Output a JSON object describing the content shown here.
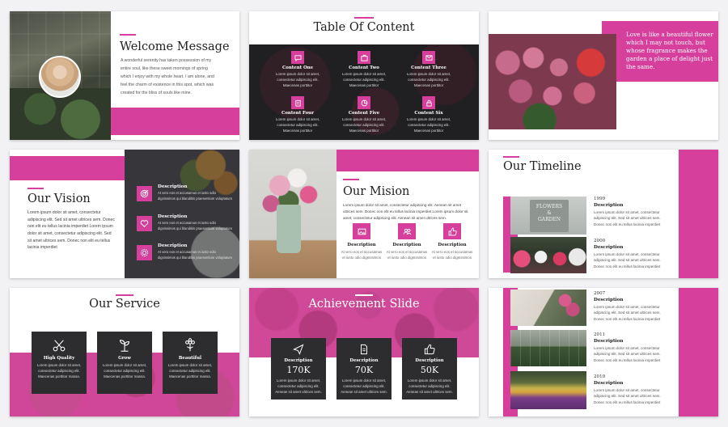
{
  "colors": {
    "accent": "#d63f9b",
    "dark": "#2d2d2f"
  },
  "s1": {
    "title": "Welcome Message",
    "body": "A wonderful serenity has taken possession of my entire soul, like these sweet mornings of spring which I enjoy with my whole heart. I am alone, and feel the charm of existence in this spot, which was created for the bliss of souls like mine."
  },
  "s2": {
    "title": "Table Of Content",
    "items": [
      {
        "title": "Content One",
        "desc": "Lorem ipsum dolor sit amet, consectetur adipiscing elit. Maecenas porttitor",
        "icon": "chat-icon"
      },
      {
        "title": "Content Two",
        "desc": "Lorem ipsum dolor sit amet, consectetur adipiscing elit. Maecenas porttitor",
        "icon": "briefcase-icon"
      },
      {
        "title": "Content Three",
        "desc": "Lorem ipsum dolor sit amet, consectetur adipiscing elit. Maecenas porttitor",
        "icon": "email-icon"
      },
      {
        "title": "Content Four",
        "desc": "Lorem ipsum dolor sit amet, consectetur adipiscing elit. Maecenas porttitor",
        "icon": "clipboard-icon"
      },
      {
        "title": "Content Five",
        "desc": "Lorem ipsum dolor sit amet, consectetur adipiscing elit. Maecenas porttitor",
        "icon": "pie-icon"
      },
      {
        "title": "Content Six",
        "desc": "Lorem ipsum dolor sit amet, consectetur adipiscing elit. Maecenas porttitor",
        "icon": "lock-icon"
      }
    ]
  },
  "s3": {
    "quote": "Love is like a beautiful flower which I may not touch, but whose fragrance makes the garden a place of delight just the same."
  },
  "s4": {
    "title": "Our Vision",
    "body": "Lorem ipsum dolor sit amet, consectetur adipiscing elit. Sed sit amet ultrices sem. Donec non elit eu tellus lacinia imperdiet Lorem ipsum dolor sit amet, consectetur adipiscing elit. Sed sit amet ultrices sem. Donec non elit eu tellus lacinia imperdiet",
    "items": [
      {
        "title": "Description",
        "desc": "At vero eos et accusamus et iusto odio dignissimos qui blanditiis praesentium voluptatum"
      },
      {
        "title": "Description",
        "desc": "At vero eos et accusamus et iusto odio dignissimos qui blanditiis praesentium voluptatum"
      },
      {
        "title": "Description",
        "desc": "At vero eos et accusamus et iusto odio dignissimos qui blanditiis praesentium voluptatum"
      }
    ]
  },
  "s5": {
    "title": "Our Mision",
    "body": "Lorem ipsum dolor sit amet, consectetur adipiscing elit. Aenean sit amet ultrices sem. Donec non elit eu tellus lacinia imperdiet Lorem ipsum dolor sit amet, consectetur adipiscing elit. Aenean sit amet ultrices sem.",
    "items": [
      {
        "title": "Description",
        "desc": "At vero eos et accusamus et iusto odio dignissimos"
      },
      {
        "title": "Description",
        "desc": "At vero eos et accusamus et iusto odio dignissimos"
      },
      {
        "title": "Description",
        "desc": "At vero eos et accusamus et iusto odio dignissimos"
      }
    ]
  },
  "s6": {
    "title": "Our Timeline",
    "entries": [
      {
        "year": "1999",
        "title": "Description",
        "desc": "Lorem ipsum dolor sit amet, consectetur adipiscing elit. Sed sit amet ultrices sem. Donec non elit eu tellus lacinia imperdiet"
      },
      {
        "year": "2000",
        "title": "Description",
        "desc": "Lorem ipsum dolor sit amet, consectetur adipiscing elit. Sed sit amet ultrices sem. Donec non elit eu tellus lacinia imperdiet"
      }
    ],
    "sign_top": "FLOWERS",
    "sign_amp": "&",
    "sign_bottom": "GARDEN"
  },
  "s7": {
    "title": "Our Service",
    "items": [
      {
        "title": "High Quality",
        "desc": "Lorem ipsum dolor sit amet, consectetur adipiscing elit. Maecenas porttitor massa.",
        "icon": "scissors-icon"
      },
      {
        "title": "Grow",
        "desc": "Lorem ipsum dolor sit amet, consectetur adipiscing elit. Maecenas porttitor massa.",
        "icon": "sprout-icon"
      },
      {
        "title": "Beautiful",
        "desc": "Lorem ipsum dolor sit amet, consectetur adipiscing elit. Maecenas porttitor massa.",
        "icon": "flower-icon"
      }
    ]
  },
  "s8": {
    "title": "Achievement Slide",
    "items": [
      {
        "title": "Description",
        "value": "170K",
        "desc": "Lorem ipsum dolor sit amet, consectetur adipiscing elit. Aenean sit amet ultrices sem.",
        "icon": "send-icon"
      },
      {
        "title": "Description",
        "value": "70K",
        "desc": "Lorem ipsum dolor sit amet, consectetur adipiscing elit. Aenean sit amet ultrices sem.",
        "icon": "document-icon"
      },
      {
        "title": "Description",
        "value": "50K",
        "desc": "Lorem ipsum dolor sit amet, consectetur adipiscing elit. Aenean sit amet ultrices sem.",
        "icon": "thumbs-up-icon"
      }
    ]
  },
  "s9": {
    "entries": [
      {
        "year": "2007",
        "title": "Description",
        "desc": "Lorem ipsum dolor sit amet, consectetur adipiscing elit. Sed sit amet ultrices sem. Donec non elit eu tellus lacinia imperdiet"
      },
      {
        "year": "2011",
        "title": "Description",
        "desc": "Lorem ipsum dolor sit amet, consectetur adipiscing elit. Sed sit amet ultrices sem. Donec non elit eu tellus lacinia imperdiet"
      },
      {
        "year": "2019",
        "title": "Description",
        "desc": "Lorem ipsum dolor sit amet, consectetur adipiscing elit. Sed sit amet ultrices sem. Donec non elit eu tellus lacinia imperdiet"
      }
    ]
  }
}
